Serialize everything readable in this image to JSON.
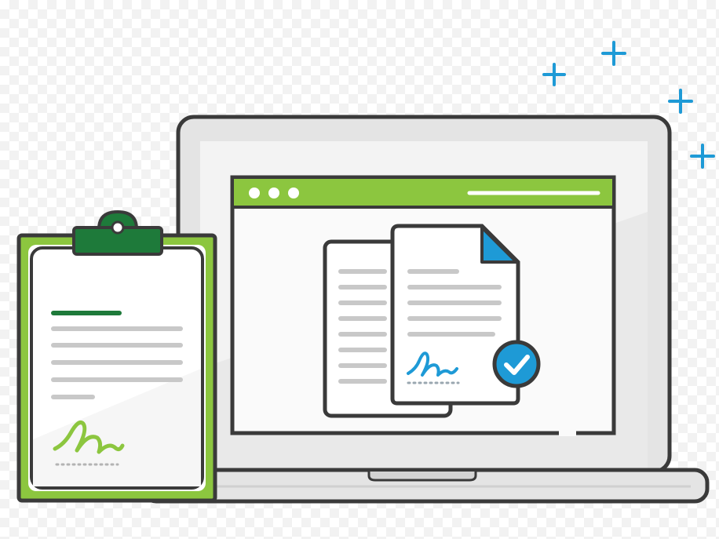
{
  "illustration": {
    "subject": "e-signature",
    "icons": [
      "laptop-icon",
      "clipboard-icon",
      "document-icon",
      "signature-icon",
      "checkmark-icon",
      "plus-sparkle-icon"
    ]
  },
  "colors": {
    "outline": "#3a3a3a",
    "green": "#8cc63f",
    "dark_green": "#1e7a3a",
    "blue": "#1e9ad6",
    "screen_bg": "#f3f3f3",
    "laptop_body": "#e4e4e4",
    "text_line": "#c8c8c8"
  }
}
